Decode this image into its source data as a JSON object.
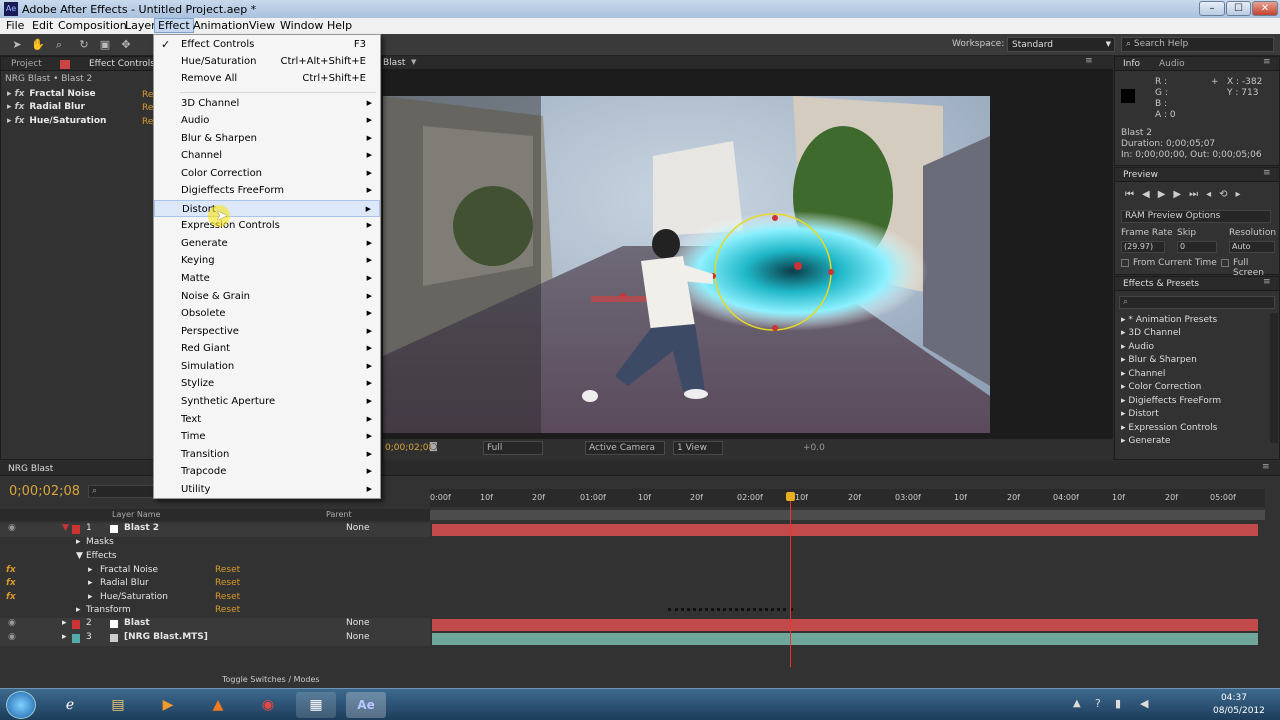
{
  "window": {
    "title": "Adobe After Effects - Untitled Project.aep *",
    "minimize": "–",
    "maximize": "☐",
    "close": "✕"
  },
  "menubar": {
    "items": [
      "File",
      "Edit",
      "Composition",
      "Layer",
      "Effect",
      "Animation",
      "View",
      "Window",
      "Help"
    ],
    "active": "Effect"
  },
  "workspace": {
    "label": "Workspace:",
    "value": "Standard",
    "search_placeholder": "Search Help"
  },
  "left_panel": {
    "tabs": {
      "project": "Project",
      "effect_controls": "Effect Controls"
    },
    "header": "NRG Blast • Blast 2",
    "effects": [
      {
        "name": "Fractal Noise",
        "reset": "Re"
      },
      {
        "name": "Radial Blur",
        "reset": "Re"
      },
      {
        "name": "Hue/Saturation",
        "reset": "Re"
      }
    ]
  },
  "effect_menu": {
    "items": [
      {
        "label": "Effect Controls",
        "shortcut": "F3",
        "checked": true
      },
      {
        "label": "Hue/Saturation",
        "shortcut": "Ctrl+Alt+Shift+E"
      },
      {
        "label": "Remove All",
        "shortcut": "Ctrl+Shift+E"
      }
    ],
    "categories": [
      "3D Channel",
      "Audio",
      "Blur & Sharpen",
      "Channel",
      "Color Correction",
      "Digieffects FreeForm",
      "Distort",
      "Expression Controls",
      "Generate",
      "Keying",
      "Matte",
      "Noise & Grain",
      "Obsolete",
      "Perspective",
      "Red Giant",
      "Simulation",
      "Stylize",
      "Synthetic Aperture",
      "Text",
      "Time",
      "Transition",
      "Trapcode",
      "Utility"
    ],
    "highlighted": "Distort"
  },
  "comp_viewer": {
    "tab": "Blast",
    "timecode": "0;00;02;08",
    "quality": "Full",
    "camera": "Active Camera",
    "views": "1 View",
    "exposure": "+0.0"
  },
  "info_panel": {
    "tabs": {
      "info": "Info",
      "audio": "Audio"
    },
    "r": "R :",
    "g": "G :",
    "b": "B :",
    "a": "A : 0",
    "x": "X : -382",
    "y": "Y : 713",
    "layer": "Blast 2",
    "duration": "Duration: 0;00;05;07",
    "in_out": "In: 0;00;00;00, Out: 0;00;05;06"
  },
  "preview_panel": {
    "title": "Preview",
    "ram_options": "RAM Preview Options",
    "frame_rate_label": "Frame Rate",
    "skip_label": "Skip",
    "resolution_label": "Resolution",
    "frame_rate": "(29.97)",
    "skip": "0",
    "resolution": "Auto",
    "from_current": "From Current Time",
    "full_screen": "Full Screen"
  },
  "effects_presets": {
    "title": "Effects & Presets",
    "items": [
      "* Animation Presets",
      "3D Channel",
      "Audio",
      "Blur & Sharpen",
      "Channel",
      "Color Correction",
      "Digieffects FreeForm",
      "Distort",
      "Expression Controls",
      "Generate"
    ]
  },
  "timeline": {
    "tab": "NRG Blast",
    "timecode": "0;00;02;08",
    "col_layer_name": "Layer Name",
    "col_parent": "Parent",
    "ruler": [
      "0:00f",
      "10f",
      "20f",
      "01:00f",
      "10f",
      "20f",
      "02:00f",
      "10f",
      "20f",
      "03:00f",
      "10f",
      "20f",
      "04:00f",
      "10f",
      "20f",
      "05:00f"
    ],
    "layers": [
      {
        "num": "1",
        "name": "Blast 2",
        "parent": "None"
      },
      {
        "num": "2",
        "name": "Blast",
        "parent": "None"
      },
      {
        "num": "3",
        "name": "[NRG Blast.MTS]",
        "parent": "None"
      }
    ],
    "sub": {
      "masks": "Masks",
      "effects": "Effects",
      "transform": "Transform"
    },
    "effects": [
      {
        "name": "Fractal Noise",
        "reset": "Reset"
      },
      {
        "name": "Radial Blur",
        "reset": "Reset"
      },
      {
        "name": "Hue/Saturation",
        "reset": "Reset"
      }
    ],
    "transform_reset": "Reset",
    "toggle": "Toggle Switches / Modes"
  },
  "taskbar": {
    "time": "04:37",
    "date": "08/05/2012",
    "ae_label": "Ae"
  }
}
